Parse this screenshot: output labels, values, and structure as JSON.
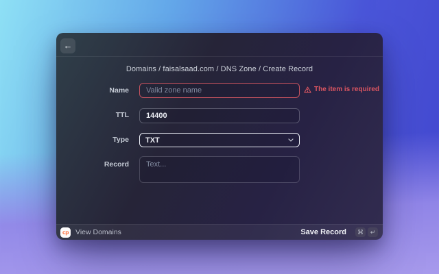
{
  "header": {
    "back_icon": "arrow-left",
    "back_glyph": "←",
    "breadcrumb": "Domains / faisalsaad.com / DNS Zone / Create Record"
  },
  "form": {
    "name": {
      "label": "Name",
      "value": "",
      "placeholder": "Valid zone name",
      "error": "The item is required",
      "error_icon": "warning-triangle"
    },
    "ttl": {
      "label": "TTL",
      "value": "14400"
    },
    "type": {
      "label": "Type",
      "value": "TXT",
      "chevron_icon": "chevron-down"
    },
    "record": {
      "label": "Record",
      "value": "",
      "placeholder": "Text..."
    }
  },
  "footer": {
    "logo_text": "cp",
    "view_domains_label": "View Domains",
    "save_record_label": "Save Record",
    "shortcut_keys": [
      {
        "icon": "command-key",
        "glyph": "⌘"
      },
      {
        "icon": "return-key",
        "glyph": "↵"
      }
    ]
  },
  "colors": {
    "error_red": "#dd5661",
    "name_field_border": "#c4525e",
    "logo_orange": "#ff6c37"
  }
}
